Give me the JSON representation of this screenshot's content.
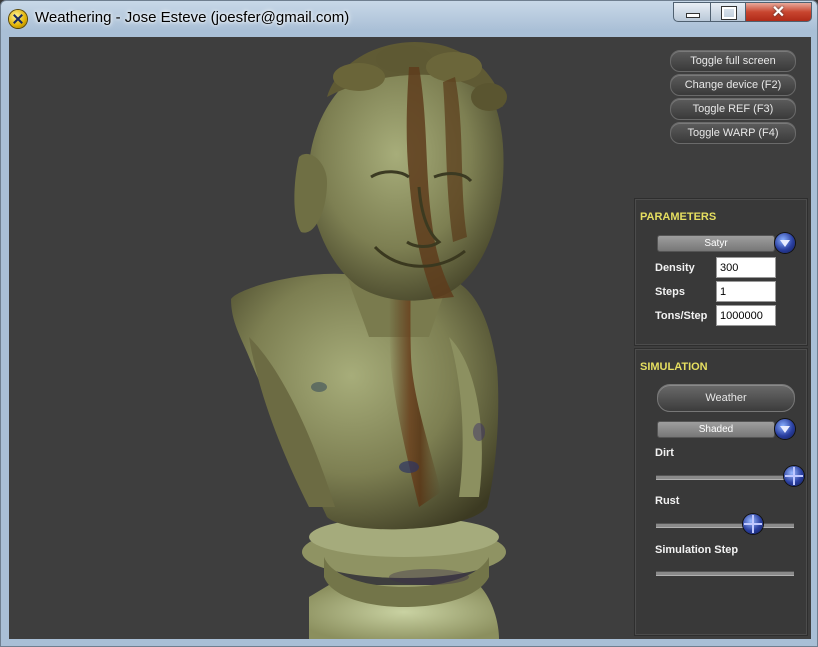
{
  "window": {
    "title": "Weathering - Jose Esteve (joesfer@gmail.com)",
    "close_glyph": "✕"
  },
  "hud": {
    "buttons": [
      {
        "label": "Toggle full screen"
      },
      {
        "label": "Change device (F2)"
      },
      {
        "label": "Toggle REF (F3)"
      },
      {
        "label": "Toggle WARP (F4)"
      }
    ]
  },
  "parameters": {
    "title": "PARAMETERS",
    "model_select": "Satyr",
    "density_label": "Density",
    "density_value": "300",
    "steps_label": "Steps",
    "steps_value": "1",
    "tons_label": "Tons/Step",
    "tons_value": "1000000"
  },
  "simulation": {
    "title": "SIMULATION",
    "weather_button": "Weather",
    "render_mode_select": "Shaded",
    "dirt_label": "Dirt",
    "dirt_level": 1.0,
    "rust_label": "Rust",
    "rust_level": 0.7,
    "sim_step_label": "Simulation Step",
    "sim_step_level": 0.0
  },
  "icons": {
    "app": "app-logo-icon",
    "minimize": "minimize-icon",
    "maximize": "maximize-icon",
    "close": "close-icon",
    "dropdown": "chevron-down-icon",
    "slider": "slider-thumb-icon"
  },
  "colors": {
    "panel_title": "#e6df60",
    "viewport_bg": "#3e3e3e",
    "close_button": "#c8452f"
  }
}
